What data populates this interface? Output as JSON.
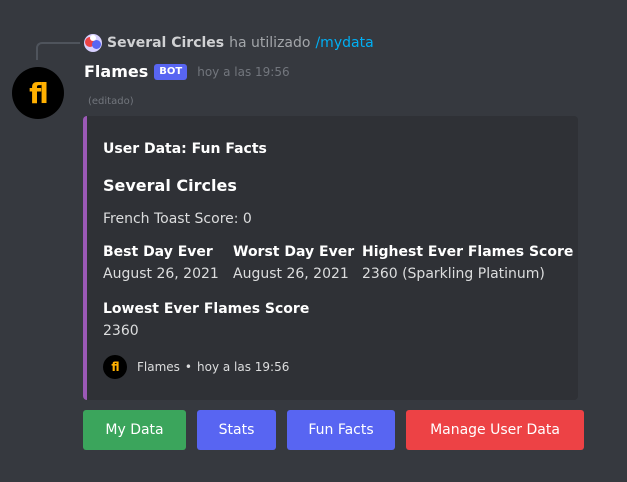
{
  "reply": {
    "user": "Several Circles",
    "verb": "ha utilizado",
    "command": "/mydata"
  },
  "message": {
    "avatar_glyph": "fl",
    "username": "Flames",
    "bot_tag": "BOT",
    "timestamp": "hoy a las 19:56",
    "edited": "(editado)"
  },
  "embed": {
    "color": "#9b59b6",
    "author": "User Data: Fun Facts",
    "title": "Several Circles",
    "description": "French Toast Score: 0",
    "fields": [
      {
        "name": "Best Day Ever",
        "value": "August 26, 2021"
      },
      {
        "name": "Worst Day Ever",
        "value": "August 26, 2021"
      },
      {
        "name": "Highest Ever Flames Score",
        "value": "2360 (Sparkling Platinum)"
      },
      {
        "name": "Lowest Ever Flames Score",
        "value": "2360"
      }
    ],
    "footer": {
      "icon_glyph": "fl",
      "text": "Flames",
      "separator": "•",
      "timestamp": "hoy a las 19:56"
    }
  },
  "buttons": [
    {
      "label": "My Data",
      "color": "#3ba55c"
    },
    {
      "label": "Stats",
      "color": "#5865f2"
    },
    {
      "label": "Fun Facts",
      "color": "#5865f2"
    },
    {
      "label": "Manage User Data",
      "color": "#ed4245"
    }
  ]
}
